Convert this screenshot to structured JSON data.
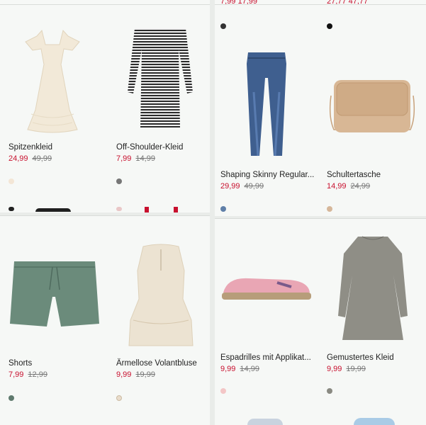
{
  "products": [
    {
      "name": "Spitzenkleid",
      "price": "24,99",
      "old_price": "49,99",
      "swatch": "#f3e6d6"
    },
    {
      "name": "Off-Shoulder-Kleid",
      "price": "7,99",
      "old_price": "14,99",
      "swatch": "#777777"
    },
    {
      "name": "Shaping Skinny Regular...",
      "price": "29,99",
      "old_price": "49,99",
      "swatch": "#5f7fa8"
    },
    {
      "name": "Schultertasche",
      "price": "14,99",
      "old_price": "24,99",
      "swatch": "#d6b79a"
    },
    {
      "name": "Shorts",
      "price": "7,99",
      "old_price": "12,99",
      "swatch": "#5f7a6e"
    },
    {
      "name": "Ärmellose Volantbluse",
      "price": "9,99",
      "old_price": "19,99",
      "swatch": "#e9dccb"
    },
    {
      "name": "Espadrilles mit Applikat...",
      "price": "9,99",
      "old_price": "14,99",
      "swatch": "#f3c6c6"
    },
    {
      "name": "Gemustertes Kleid",
      "price": "9,99",
      "old_price": "19,99",
      "swatch": "#8a8a82"
    }
  ],
  "top_peek": {
    "left": "7,99 17,99",
    "right": "27,77 47,77"
  },
  "colors": {
    "sale": "#c8102e",
    "text": "#222222",
    "muted": "#777777"
  }
}
